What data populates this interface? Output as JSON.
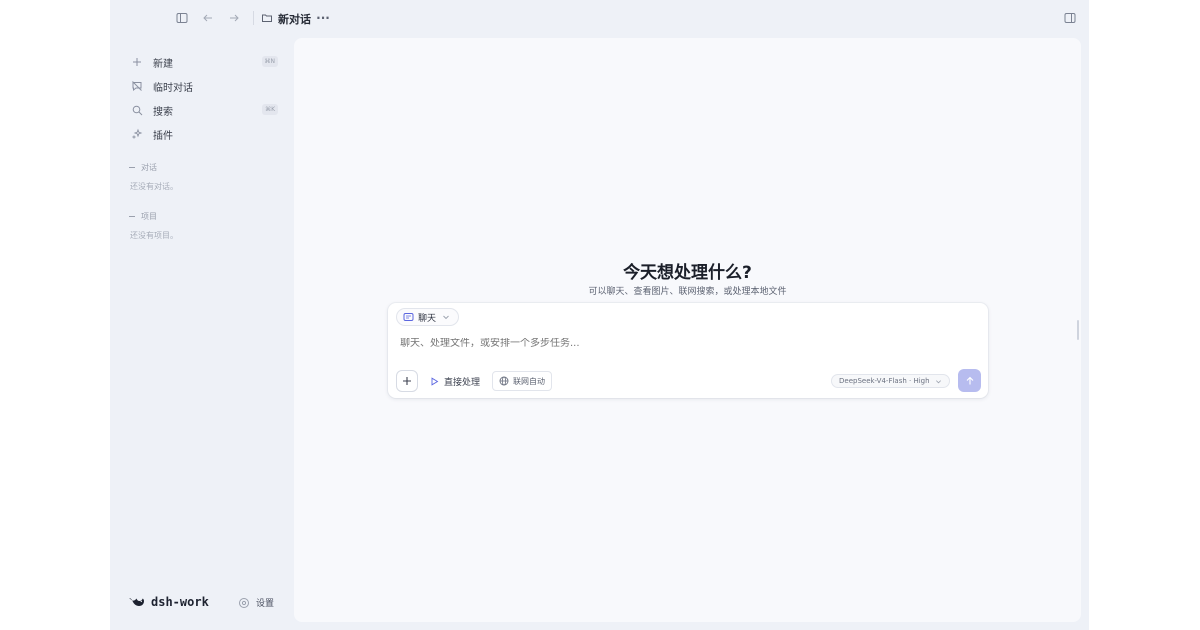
{
  "topbar": {
    "title": "新对话",
    "more": "···"
  },
  "sidebar": {
    "items": [
      {
        "label": "新建",
        "icon": "plus-icon",
        "shortcut": "⌘N"
      },
      {
        "label": "临时对话",
        "icon": "temp-chat-icon"
      },
      {
        "label": "搜索",
        "icon": "search-icon",
        "shortcut": "⌘K"
      },
      {
        "label": "插件",
        "icon": "sparkle-icon"
      }
    ],
    "sections": [
      {
        "title": "对话",
        "empty": "还没有对话。"
      },
      {
        "title": "项目",
        "empty": "还没有项目。"
      }
    ],
    "brand": "dsh-work",
    "settings_label": "设置"
  },
  "main": {
    "title": "今天想处理什么?",
    "subtitle": "可以聊天、查看图片、联网搜索，或处理本地文件",
    "composer": {
      "mode": "聊天",
      "placeholder": "聊天、处理文件，或安排一个多步任务...",
      "direct_label": "直接处理",
      "web_label": "联网自动",
      "model": "DeepSeek-V4-Flash · High"
    }
  },
  "colors": {
    "sidebar_bg": "#eef1f7",
    "panel_bg": "#f8f9fc",
    "send_button": "#b7bcef",
    "accent": "#5b66e0"
  }
}
